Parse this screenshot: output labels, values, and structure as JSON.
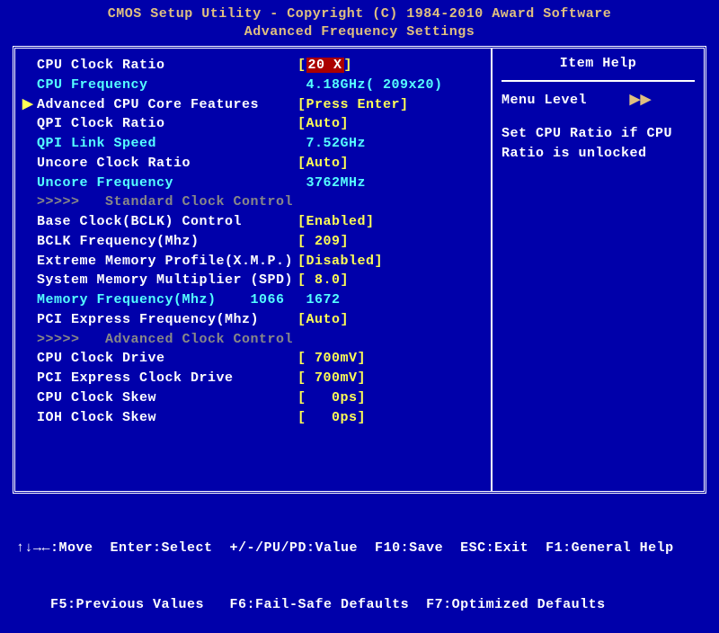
{
  "header": {
    "title_line1": "CMOS Setup Utility - Copyright (C) 1984-2010 Award Software",
    "title_line2": "Advanced Frequency Settings"
  },
  "rows": [
    {
      "cursor": "",
      "label": "CPU Clock Ratio",
      "lclass": "white",
      "pre": "[",
      "val": "20 X",
      "post": "]",
      "vstyle": "hl"
    },
    {
      "cursor": "",
      "label": "CPU Frequency",
      "lclass": "cyan",
      "pre": " ",
      "val": "4.18GHz( 209x20)",
      "post": "",
      "vstyle": "cyan"
    },
    {
      "cursor": "▶",
      "label": "Advanced CPU Core Features",
      "lclass": "white",
      "pre": "[",
      "val": "Press Enter",
      "post": "]",
      "vstyle": "yellow"
    },
    {
      "cursor": "",
      "label": "QPI Clock Ratio",
      "lclass": "white",
      "pre": "[",
      "val": "Auto",
      "post": "]",
      "vstyle": "yellow"
    },
    {
      "cursor": "",
      "label": "QPI Link Speed",
      "lclass": "cyan",
      "pre": " ",
      "val": "7.52GHz",
      "post": "",
      "vstyle": "cyan"
    },
    {
      "cursor": "",
      "label": "Uncore Clock Ratio",
      "lclass": "white",
      "pre": "[",
      "val": "Auto",
      "post": "]",
      "vstyle": "yellow"
    },
    {
      "cursor": "",
      "label": "Uncore Frequency",
      "lclass": "cyan",
      "pre": " ",
      "val": "3762MHz",
      "post": "",
      "vstyle": "cyan"
    },
    {
      "cursor": "",
      "label": ">>>>>   Standard Clock Control",
      "lclass": "grey",
      "pre": "",
      "val": "",
      "post": "",
      "vstyle": ""
    },
    {
      "cursor": "",
      "label": "Base Clock(BCLK) Control",
      "lclass": "white",
      "pre": "[",
      "val": "Enabled",
      "post": "]",
      "vstyle": "yellow"
    },
    {
      "cursor": "",
      "label": "BCLK Frequency(Mhz)",
      "lclass": "white",
      "pre": "[",
      "val": " 209",
      "post": "]",
      "vstyle": "yellow"
    },
    {
      "cursor": "",
      "label": "Extreme Memory Profile(X.M.P.)",
      "lclass": "white",
      "pre": "[",
      "val": "Disabled",
      "post": "]",
      "vstyle": "yellow"
    },
    {
      "cursor": "",
      "label": "System Memory Multiplier (SPD)",
      "lclass": "white",
      "pre": "[",
      "val": " 8.0",
      "post": "]",
      "vstyle": "yellow"
    },
    {
      "cursor": "",
      "label": "Memory Frequency(Mhz)    1066",
      "lclass": "cyan",
      "pre": " ",
      "val": "1672",
      "post": "",
      "vstyle": "cyan"
    },
    {
      "cursor": "",
      "label": "PCI Express Frequency(Mhz)",
      "lclass": "white",
      "pre": "[",
      "val": "Auto",
      "post": "]",
      "vstyle": "yellow"
    },
    {
      "cursor": "",
      "label": ">>>>>   Advanced Clock Control",
      "lclass": "grey",
      "pre": "",
      "val": "",
      "post": "",
      "vstyle": ""
    },
    {
      "cursor": "",
      "label": "CPU Clock Drive",
      "lclass": "white",
      "pre": "[",
      "val": " 700mV",
      "post": "]",
      "vstyle": "yellow"
    },
    {
      "cursor": "",
      "label": "PCI Express Clock Drive",
      "lclass": "white",
      "pre": "[",
      "val": " 700mV",
      "post": "]",
      "vstyle": "yellow"
    },
    {
      "cursor": "",
      "label": "CPU Clock Skew",
      "lclass": "white",
      "pre": "[",
      "val": "   0ps",
      "post": "]",
      "vstyle": "yellow"
    },
    {
      "cursor": "",
      "label": "IOH Clock Skew",
      "lclass": "white",
      "pre": "[",
      "val": "   0ps",
      "post": "]",
      "vstyle": "yellow"
    }
  ],
  "help": {
    "title": "Item Help",
    "menu_level_label": "Menu Level",
    "menu_level_arrows": "▶▶",
    "text": "Set CPU Ratio if CPU\nRatio is unlocked"
  },
  "footer": {
    "line1": "↑↓→←:Move  Enter:Select  +/-/PU/PD:Value  F10:Save  ESC:Exit  F1:General Help",
    "line2": "    F5:Previous Values   F6:Fail-Safe Defaults  F7:Optimized Defaults"
  }
}
